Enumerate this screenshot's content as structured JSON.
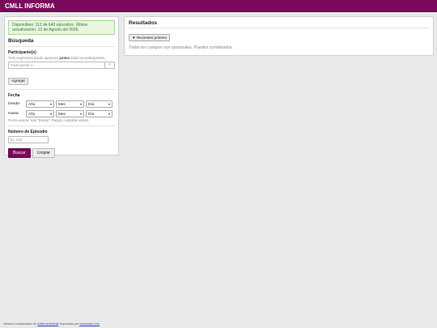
{
  "app": {
    "title": "CMLL INFORMA"
  },
  "search": {
    "notice": "Disponibles: 112 de 640 episodios. Última actualización: 12 de Agosto del 2026.",
    "title": "Búsqueda",
    "participants": {
      "label": "Participante(s)",
      "hint_before": "Todo segmentos donde aparecen",
      "hint_bold": "juntos",
      "hint_after": "todos los participantes.",
      "placeholder": "Participante 1...",
      "clear_label": "×",
      "add_label": "Agregar"
    },
    "date": {
      "label": "Fecha",
      "from_label": "Desde:",
      "to_label": "Hasta:",
      "year_placeholder": "Año",
      "month_placeholder": "Mes",
      "day_placeholder": "Día",
      "hint": "Fecha exacta: solo \"Desde\". Rango: completa ambas."
    },
    "episode": {
      "label": "Número de Episodio",
      "placeholder": "Ej. 145"
    },
    "submit_label": "Buscar",
    "reset_label": "Limpiar"
  },
  "results": {
    "title": "Resultados",
    "sort_label": "▼ Recientes primero",
    "empty_message": "Todos los campos son opcionales. Puedes combinarlos."
  },
  "footer": {
    "prefix": "Versión a subsanación de",
    "link1": "twitter/cmlloficial",
    "middle": ". Impulsado por",
    "link2": "somosweb.com"
  },
  "colors": {
    "brand": "#7b0a5c",
    "notice_bg": "#e7f5e1",
    "notice_text": "#3c7a2c"
  }
}
